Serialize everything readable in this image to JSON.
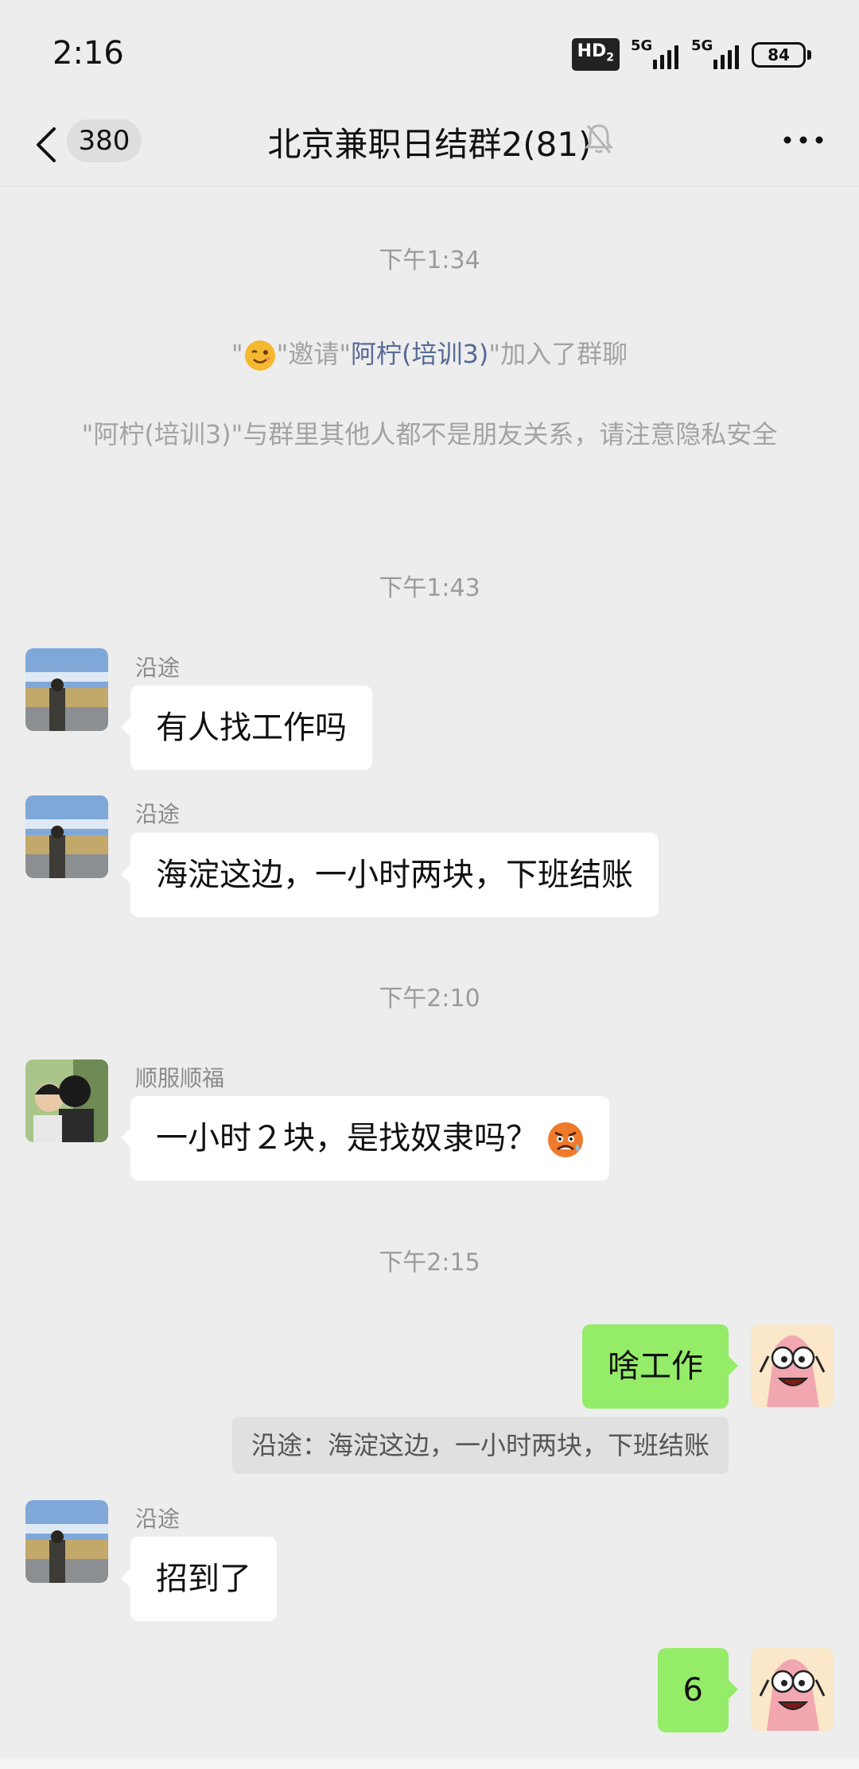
{
  "status_bar": {
    "time": "2:16",
    "network_badge": "HD",
    "network_badge_sub": "2",
    "signal_1_label": "5G",
    "signal_2_label": "5G",
    "battery": "84"
  },
  "header": {
    "unread_count": "380",
    "title": "北京兼职日结群2(81)"
  },
  "messages": {
    "time_1": "下午1:34",
    "invite_prefix": "\"",
    "invite_mid": "\"邀请\"",
    "invite_name": "阿柠(培训3)",
    "invite_suffix": "\"加入了群聊",
    "privacy_notice": "\"阿柠(培训3)\"与群里其他人都不是朋友关系，请注意隐私安全",
    "time_2": "下午1:43",
    "msg_1_sender": "沿途",
    "msg_1_text": "有人找工作吗",
    "msg_2_sender": "沿途",
    "msg_2_text": "海淀这边，一小时两块，下班结账",
    "time_3": "下午2:10",
    "msg_3_sender": "顺服顺福",
    "msg_3_text": "一小时２块，是找奴隶吗？",
    "time_4": "下午2:15",
    "msg_4_text": "啥工作",
    "msg_4_quote": "沿途：海淀这边，一小时两块，下班结账",
    "msg_5_sender": "沿途",
    "msg_5_text": "招到了",
    "msg_6_text": "6"
  },
  "colors": {
    "background": "#ededed",
    "bubble_self": "#95ec69",
    "bubble_other": "#ffffff",
    "link": "#576b95"
  },
  "icons": [
    "back-chevron-icon",
    "mute-bell-icon",
    "more-dots-icon",
    "wink-emoji-icon",
    "angry-emoji-icon"
  ]
}
